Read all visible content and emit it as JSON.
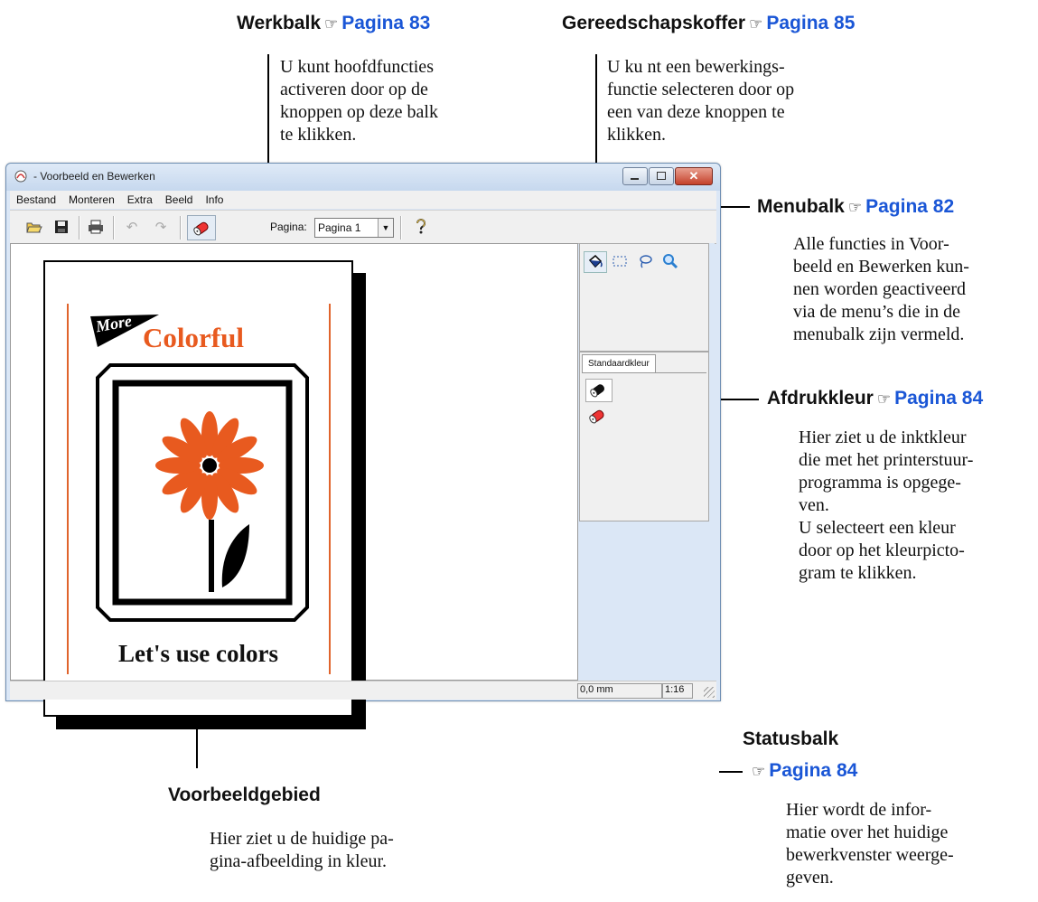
{
  "callouts": {
    "werkbalk": {
      "title": "Werkbalk",
      "ref": "Pagina 83",
      "lines": [
        "U kunt hoofdfuncties",
        "activeren door op de",
        "knoppen op deze balk",
        "te klikken."
      ]
    },
    "gereedschapskoffer": {
      "title": "Gereedschapskoffer",
      "ref": "Pagina 85",
      "lines": [
        "U ku  nt een bewerkings-",
        "functie selecteren door op",
        "een van deze knoppen te",
        "klikken."
      ]
    },
    "menubalk": {
      "title": "Menubalk",
      "ref": "Pagina 82",
      "lines": [
        "Alle functies in Voor-",
        "beeld en Bewerken kun-",
        "nen worden geactiveerd",
        "via de menu’s die in de",
        "menubalk zijn vermeld."
      ]
    },
    "afdrukkleur": {
      "title": "Afdrukkleur",
      "ref": "Pagina 84",
      "lines": [
        "Hier ziet u de inktkleur",
        "die met het printerstuur-",
        "programma is opgege-",
        "ven.",
        "U selecteert een kleur",
        "door op het kleurpicto-",
        "gram te klikken."
      ]
    },
    "statusbalk": {
      "title": "Statusbalk",
      "ref": "Pagina 84",
      "lines": [
        "Hier wordt de infor-",
        "matie over het huidige",
        "bewerkvenster weerge-",
        "geven."
      ]
    },
    "voorbeeldgebied": {
      "title": "Voorbeeldgebied",
      "lines": [
        "Hier ziet u de huidige pa-",
        "gina-afbeelding in kleur."
      ]
    }
  },
  "window": {
    "title": "- Voorbeeld en Bewerken",
    "menu": [
      "Bestand",
      "Monteren",
      "Extra",
      "Beeld",
      "Info"
    ],
    "toolbar": {
      "page_label": "Pagina:",
      "page_value": "Pagina 1"
    },
    "tab_label": "Standaardkleur",
    "status": {
      "position": "0,0 mm",
      "zoom": "1:16"
    }
  },
  "sample_page": {
    "more": "More",
    "colorful": "Colorful",
    "caption": "Let's use colors"
  },
  "colors": {
    "link": "#1a56d6",
    "orange": "#e85a1f"
  },
  "icons": [
    "hand-pointer-icon",
    "open-folder-icon",
    "save-disk-icon",
    "printer-icon",
    "undo-icon",
    "redo-icon",
    "eraser-icon",
    "help-icon",
    "fill-bucket-icon",
    "rect-select-icon",
    "lasso-icon",
    "magnifier-icon",
    "black-ink-icon",
    "color-ink-icon"
  ]
}
